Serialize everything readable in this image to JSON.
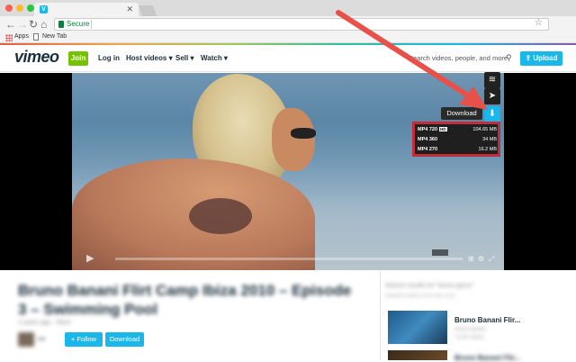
{
  "browser": {
    "tab_title": "",
    "address_secure": "Secure",
    "bookmarks": [
      "Apps",
      "New Tab"
    ]
  },
  "vimeo": {
    "logo": "vimeo",
    "join": "Join",
    "nav": [
      "Log in",
      "Host videos ▾",
      "Sell ▾",
      "Watch ▾"
    ],
    "search_placeholder": "Search videos, people, and more",
    "upload": "Upload"
  },
  "player": {
    "download_tip": "Download",
    "options": [
      {
        "quality": "MP4 720",
        "badge": "HD",
        "size": "104.65 MB"
      },
      {
        "quality": "MP4 360",
        "badge": "",
        "size": "34 MB"
      },
      {
        "quality": "MP4 270",
        "badge": "",
        "size": "16.2 MB"
      }
    ]
  },
  "video_info": {
    "title": "Bruno Banani Flirt Camp Ibiza 2010 – Episode 3 – Swimming Pool",
    "meta": "4 years ago · More",
    "follow": "+ Follow",
    "download": "Download"
  },
  "related": {
    "heading": "Search results for \"bruno ganzi\"",
    "subheading": "Related videos from this user",
    "item1_title": "Bruno Banani Flir...",
    "item1_desc": "bruno banani",
    "item1_meta": "76.3K views",
    "item2_title": "Bruno Banani Flir..."
  },
  "colors": {
    "accent": "#1ab7ea",
    "join_green": "#75c300",
    "highlight_red": "#c32d3a"
  }
}
